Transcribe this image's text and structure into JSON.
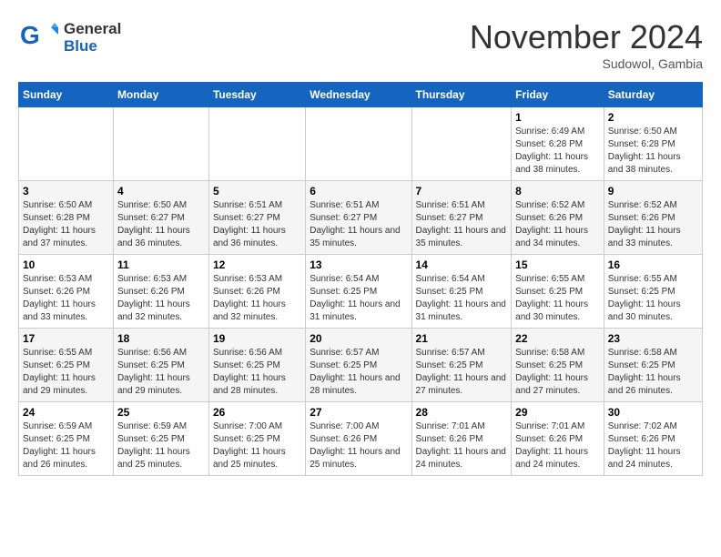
{
  "logo": {
    "general": "General",
    "blue": "Blue"
  },
  "header": {
    "month": "November 2024",
    "location": "Sudowol, Gambia"
  },
  "weekdays": [
    "Sunday",
    "Monday",
    "Tuesday",
    "Wednesday",
    "Thursday",
    "Friday",
    "Saturday"
  ],
  "weeks": [
    [
      {
        "day": "",
        "info": ""
      },
      {
        "day": "",
        "info": ""
      },
      {
        "day": "",
        "info": ""
      },
      {
        "day": "",
        "info": ""
      },
      {
        "day": "",
        "info": ""
      },
      {
        "day": "1",
        "info": "Sunrise: 6:49 AM\nSunset: 6:28 PM\nDaylight: 11 hours and 38 minutes."
      },
      {
        "day": "2",
        "info": "Sunrise: 6:50 AM\nSunset: 6:28 PM\nDaylight: 11 hours and 38 minutes."
      }
    ],
    [
      {
        "day": "3",
        "info": "Sunrise: 6:50 AM\nSunset: 6:28 PM\nDaylight: 11 hours and 37 minutes."
      },
      {
        "day": "4",
        "info": "Sunrise: 6:50 AM\nSunset: 6:27 PM\nDaylight: 11 hours and 36 minutes."
      },
      {
        "day": "5",
        "info": "Sunrise: 6:51 AM\nSunset: 6:27 PM\nDaylight: 11 hours and 36 minutes."
      },
      {
        "day": "6",
        "info": "Sunrise: 6:51 AM\nSunset: 6:27 PM\nDaylight: 11 hours and 35 minutes."
      },
      {
        "day": "7",
        "info": "Sunrise: 6:51 AM\nSunset: 6:27 PM\nDaylight: 11 hours and 35 minutes."
      },
      {
        "day": "8",
        "info": "Sunrise: 6:52 AM\nSunset: 6:26 PM\nDaylight: 11 hours and 34 minutes."
      },
      {
        "day": "9",
        "info": "Sunrise: 6:52 AM\nSunset: 6:26 PM\nDaylight: 11 hours and 33 minutes."
      }
    ],
    [
      {
        "day": "10",
        "info": "Sunrise: 6:53 AM\nSunset: 6:26 PM\nDaylight: 11 hours and 33 minutes."
      },
      {
        "day": "11",
        "info": "Sunrise: 6:53 AM\nSunset: 6:26 PM\nDaylight: 11 hours and 32 minutes."
      },
      {
        "day": "12",
        "info": "Sunrise: 6:53 AM\nSunset: 6:26 PM\nDaylight: 11 hours and 32 minutes."
      },
      {
        "day": "13",
        "info": "Sunrise: 6:54 AM\nSunset: 6:25 PM\nDaylight: 11 hours and 31 minutes."
      },
      {
        "day": "14",
        "info": "Sunrise: 6:54 AM\nSunset: 6:25 PM\nDaylight: 11 hours and 31 minutes."
      },
      {
        "day": "15",
        "info": "Sunrise: 6:55 AM\nSunset: 6:25 PM\nDaylight: 11 hours and 30 minutes."
      },
      {
        "day": "16",
        "info": "Sunrise: 6:55 AM\nSunset: 6:25 PM\nDaylight: 11 hours and 30 minutes."
      }
    ],
    [
      {
        "day": "17",
        "info": "Sunrise: 6:55 AM\nSunset: 6:25 PM\nDaylight: 11 hours and 29 minutes."
      },
      {
        "day": "18",
        "info": "Sunrise: 6:56 AM\nSunset: 6:25 PM\nDaylight: 11 hours and 29 minutes."
      },
      {
        "day": "19",
        "info": "Sunrise: 6:56 AM\nSunset: 6:25 PM\nDaylight: 11 hours and 28 minutes."
      },
      {
        "day": "20",
        "info": "Sunrise: 6:57 AM\nSunset: 6:25 PM\nDaylight: 11 hours and 28 minutes."
      },
      {
        "day": "21",
        "info": "Sunrise: 6:57 AM\nSunset: 6:25 PM\nDaylight: 11 hours and 27 minutes."
      },
      {
        "day": "22",
        "info": "Sunrise: 6:58 AM\nSunset: 6:25 PM\nDaylight: 11 hours and 27 minutes."
      },
      {
        "day": "23",
        "info": "Sunrise: 6:58 AM\nSunset: 6:25 PM\nDaylight: 11 hours and 26 minutes."
      }
    ],
    [
      {
        "day": "24",
        "info": "Sunrise: 6:59 AM\nSunset: 6:25 PM\nDaylight: 11 hours and 26 minutes."
      },
      {
        "day": "25",
        "info": "Sunrise: 6:59 AM\nSunset: 6:25 PM\nDaylight: 11 hours and 25 minutes."
      },
      {
        "day": "26",
        "info": "Sunrise: 7:00 AM\nSunset: 6:25 PM\nDaylight: 11 hours and 25 minutes."
      },
      {
        "day": "27",
        "info": "Sunrise: 7:00 AM\nSunset: 6:26 PM\nDaylight: 11 hours and 25 minutes."
      },
      {
        "day": "28",
        "info": "Sunrise: 7:01 AM\nSunset: 6:26 PM\nDaylight: 11 hours and 24 minutes."
      },
      {
        "day": "29",
        "info": "Sunrise: 7:01 AM\nSunset: 6:26 PM\nDaylight: 11 hours and 24 minutes."
      },
      {
        "day": "30",
        "info": "Sunrise: 7:02 AM\nSunset: 6:26 PM\nDaylight: 11 hours and 24 minutes."
      }
    ]
  ]
}
